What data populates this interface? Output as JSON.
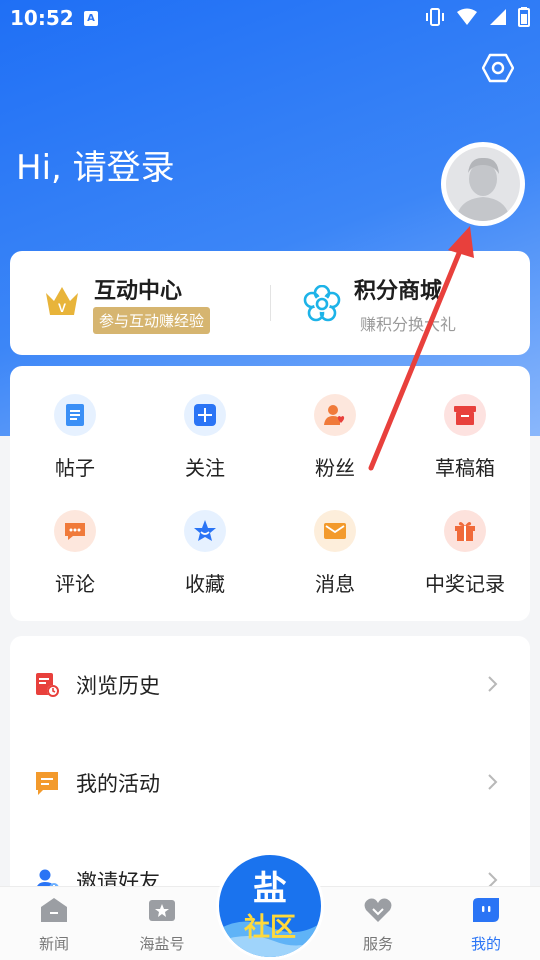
{
  "status_bar": {
    "time": "10:52",
    "notification_badge": "A"
  },
  "header": {
    "greeting": "Hi, 请登录"
  },
  "top_card": {
    "hub": {
      "title": "互动中心",
      "badge": "参与互动赚经验"
    },
    "shop": {
      "title": "积分商城",
      "subtitle": "赚积分换大礼"
    }
  },
  "grid": {
    "items": [
      {
        "label": "帖子",
        "icon": "post-icon",
        "color": "#e6f1ff"
      },
      {
        "label": "关注",
        "icon": "follow-plus-icon",
        "color": "#e6f1ff"
      },
      {
        "label": "粉丝",
        "icon": "fans-icon",
        "color": "#fde7dd"
      },
      {
        "label": "草稿箱",
        "icon": "drafts-icon",
        "color": "#fde2e0"
      },
      {
        "label": "评论",
        "icon": "comment-icon",
        "color": "#fde7dd"
      },
      {
        "label": "收藏",
        "icon": "star-icon",
        "color": "#e6f1ff"
      },
      {
        "label": "消息",
        "icon": "message-icon",
        "color": "#fdeedb"
      },
      {
        "label": "中奖记录",
        "icon": "gift-icon",
        "color": "#fde2dc"
      }
    ]
  },
  "list": {
    "items": [
      {
        "label": "浏览历史",
        "icon": "history-icon"
      },
      {
        "label": "我的活动",
        "icon": "activity-icon"
      },
      {
        "label": "邀请好友",
        "icon": "invite-icon"
      }
    ]
  },
  "tab_bar": {
    "tabs": [
      {
        "label": "新闻",
        "icon": "news-icon"
      },
      {
        "label": "海盐号",
        "icon": "haiyan-icon"
      },
      {
        "label": "服务",
        "icon": "service-icon"
      },
      {
        "label": "我的",
        "icon": "mine-icon",
        "active": true
      }
    ],
    "center": {
      "line1": "盐",
      "line2": "社区"
    }
  },
  "colors": {
    "primary": "#2a74f5",
    "gold": "#d6b570",
    "annotation_arrow": "#e8403c"
  }
}
